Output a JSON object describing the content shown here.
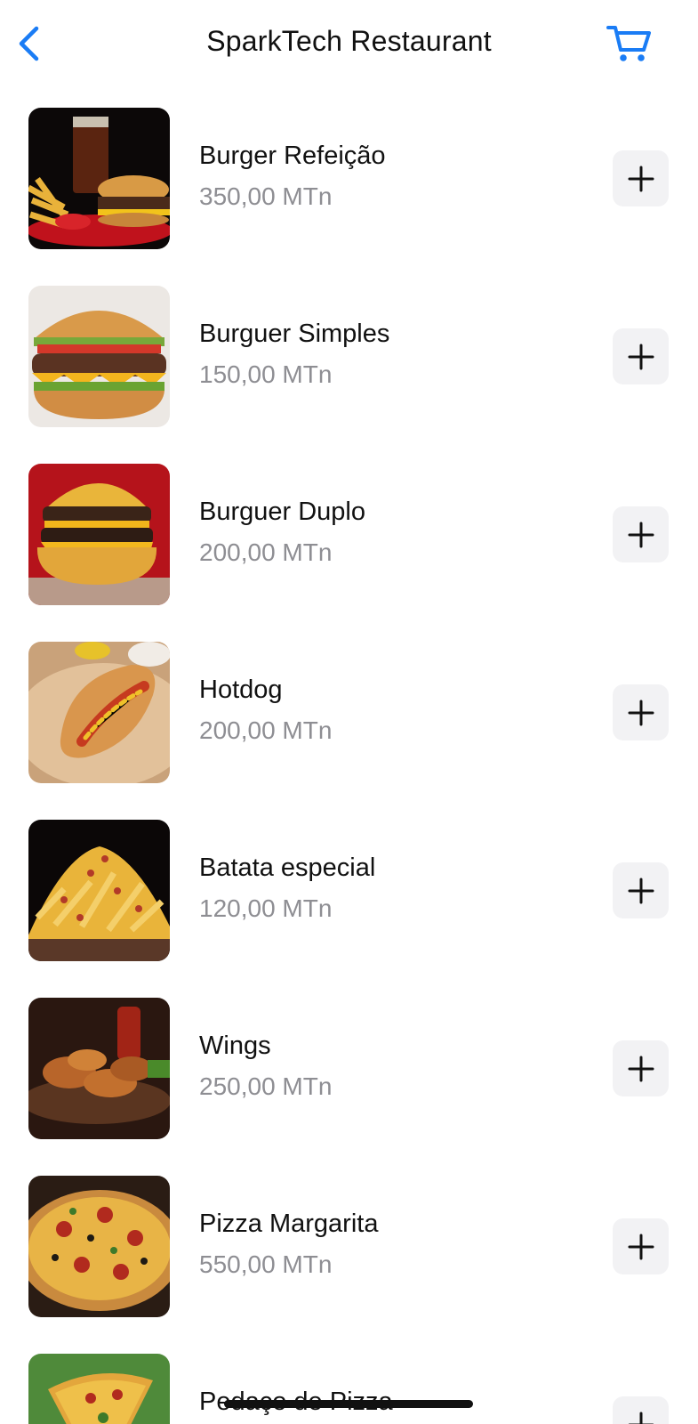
{
  "header": {
    "title": "SparkTech Restaurant",
    "back_icon": "chevron-left-icon",
    "cart_icon": "cart-icon"
  },
  "colors": {
    "accent": "#1a7cf5",
    "price_gray": "#8e8e93",
    "button_bg": "#f2f2f4"
  },
  "menu": {
    "items": [
      {
        "name": "Burger Refeição",
        "price": "350,00 MTn",
        "image": "burger-meal-photo"
      },
      {
        "name": "Burguer Simples",
        "price": "150,00 MTn",
        "image": "simple-burger-photo"
      },
      {
        "name": "Burguer Duplo",
        "price": "200,00 MTn",
        "image": "double-burger-photo"
      },
      {
        "name": "Hotdog",
        "price": "200,00 MTn",
        "image": "hotdog-photo"
      },
      {
        "name": "Batata especial",
        "price": "120,00 MTn",
        "image": "loaded-fries-photo"
      },
      {
        "name": "Wings",
        "price": "250,00 MTn",
        "image": "chicken-wings-photo"
      },
      {
        "name": "Pizza Margarita",
        "price": "550,00 MTn",
        "image": "pizza-photo"
      },
      {
        "name": "Pedaço de Pizza",
        "price": "",
        "image": "pizza-slice-photo"
      }
    ]
  }
}
